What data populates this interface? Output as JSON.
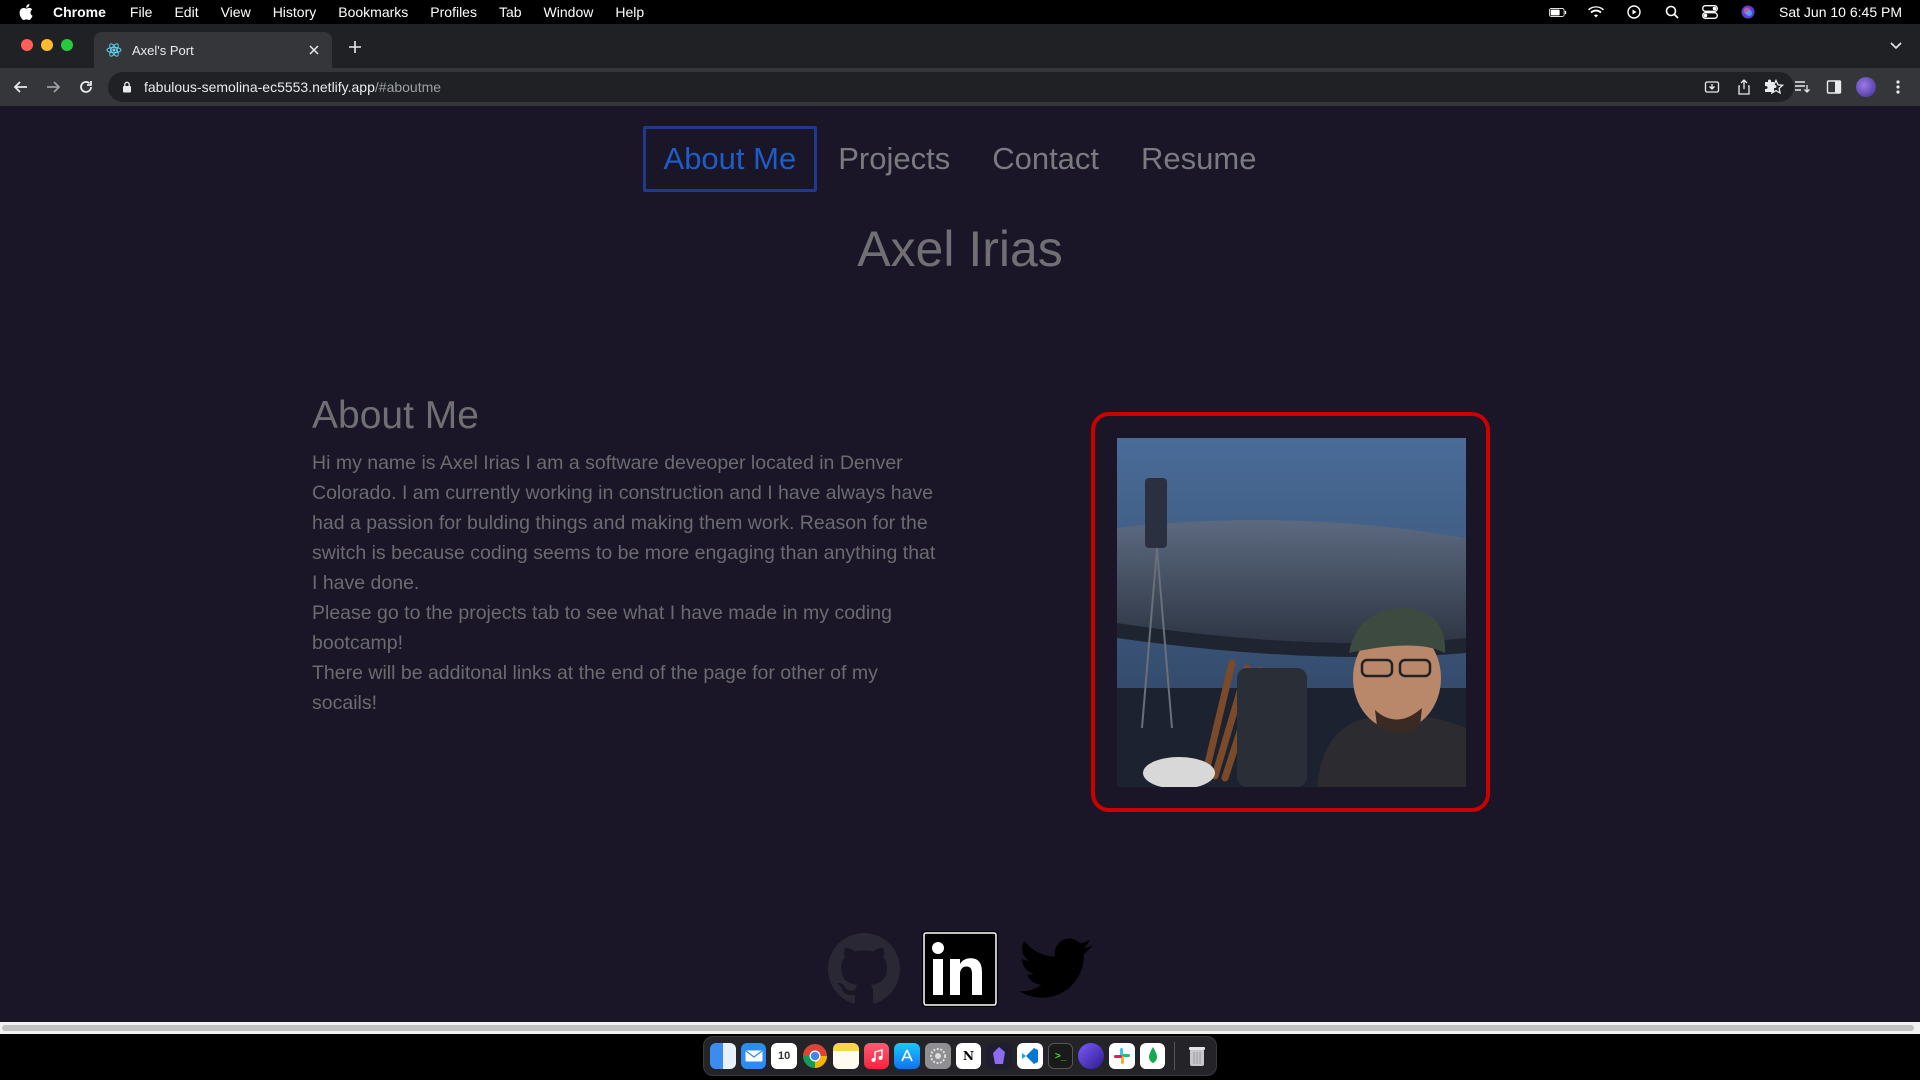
{
  "menubar": {
    "app_name": "Chrome",
    "items": [
      "File",
      "Edit",
      "View",
      "History",
      "Bookmarks",
      "Profiles",
      "Tab",
      "Window",
      "Help"
    ],
    "clock": "Sat Jun 10  6:45 PM"
  },
  "browser": {
    "tab_title": "Axel's Port",
    "url_host": "fabulous-semolina-ec5553.netlify.app",
    "url_path": "/#aboutme"
  },
  "site": {
    "nav": [
      "About Me",
      "Projects",
      "Contact",
      "Resume"
    ],
    "active_nav": "About Me",
    "title": "Axel Irias",
    "about_heading": "About Me",
    "about_paragraphs": [
      "Hi my name is Axel Irias I am a software deveoper located in Denver Colorado. I am currently working in construction and I have always have had a passion for bulding things and making them work. Reason for the switch is because coding seems to be more engaging than anything that I have done.",
      "Please go to the projects tab to see what I have made in my coding bootcamp!",
      "There will be additonal links at the end of the page for other of my socails!"
    ],
    "social_icons": [
      "github-icon",
      "linkedin-icon",
      "twitter-icon"
    ],
    "colors": {
      "background": "#1a1627",
      "active_nav": "#1e5cc8",
      "photo_border": "#cc0000"
    }
  },
  "dock": {
    "apps": [
      "Finder",
      "Mail",
      "Calendar",
      "Chrome",
      "Notes",
      "Music",
      "App Store",
      "System Settings",
      "Notion",
      "Obsidian",
      "VS Code",
      "Terminal",
      "Arc",
      "Slack",
      "MongoDB Compass",
      "Trash"
    ],
    "calendar_day": "10"
  }
}
